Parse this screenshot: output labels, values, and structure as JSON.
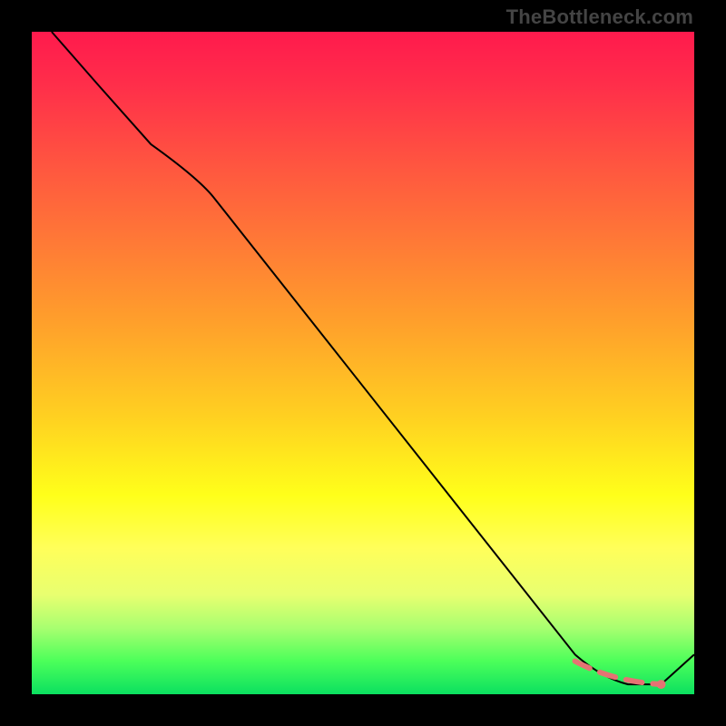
{
  "watermark": "TheBottleneck.com",
  "chart_data": {
    "type": "line",
    "title": "",
    "xlabel": "",
    "ylabel": "",
    "xlim": [
      0,
      100
    ],
    "ylim": [
      0,
      100
    ],
    "grid": false,
    "series": [
      {
        "name": "curve",
        "x": [
          3,
          10,
          18,
          25,
          82,
          86,
          90,
          95,
          100
        ],
        "values": [
          100,
          92,
          83,
          78,
          6,
          2.5,
          1.5,
          1.5,
          6
        ]
      },
      {
        "name": "optimal-range",
        "style": "dashed",
        "color": "#e57373",
        "x": [
          82,
          95
        ],
        "values": [
          5,
          1.5
        ]
      }
    ],
    "annotations": [
      {
        "type": "point",
        "name": "optimal-point",
        "x": 95,
        "y": 1.5,
        "color": "#e57373"
      }
    ]
  }
}
